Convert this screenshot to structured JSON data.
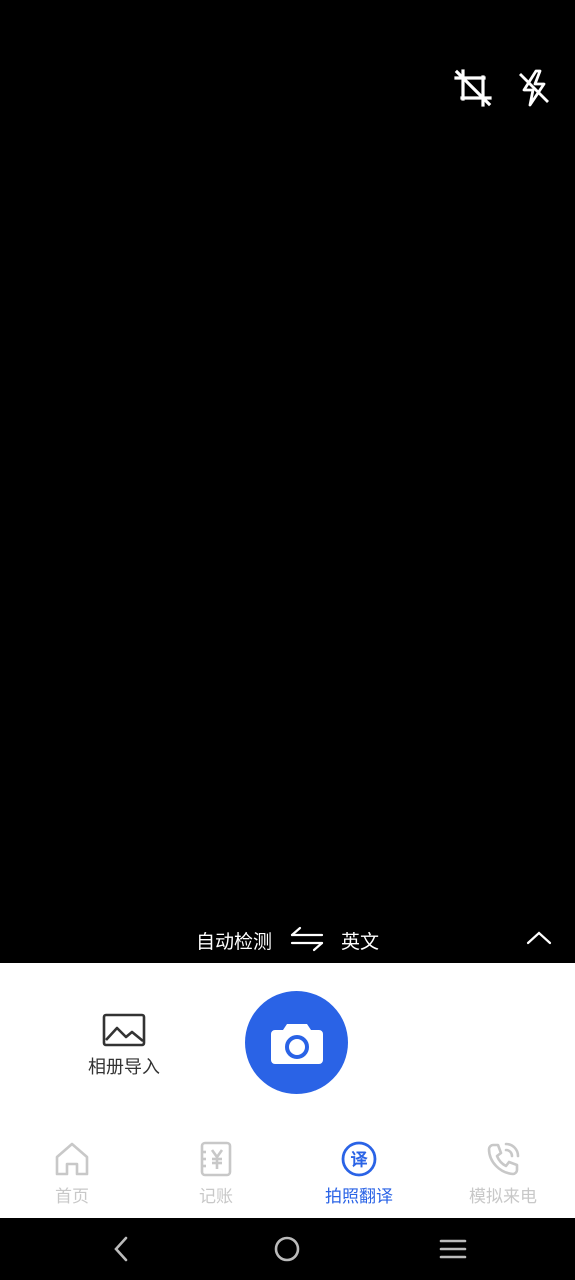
{
  "language": {
    "source": "自动检测",
    "target": "英文"
  },
  "actions": {
    "gallery_label": "相册导入"
  },
  "tabs": [
    {
      "label": "首页",
      "icon": "home-icon",
      "active": false
    },
    {
      "label": "记账",
      "icon": "yen-ledger-icon",
      "active": false
    },
    {
      "label": "拍照翻译",
      "icon": "translate-icon",
      "active": true,
      "icon_text": "译"
    },
    {
      "label": "模拟来电",
      "icon": "phone-call-icon",
      "active": false
    }
  ],
  "colors": {
    "accent": "#2a63e6",
    "inactive": "#c8c8c8",
    "camera_bg": "#000000"
  }
}
